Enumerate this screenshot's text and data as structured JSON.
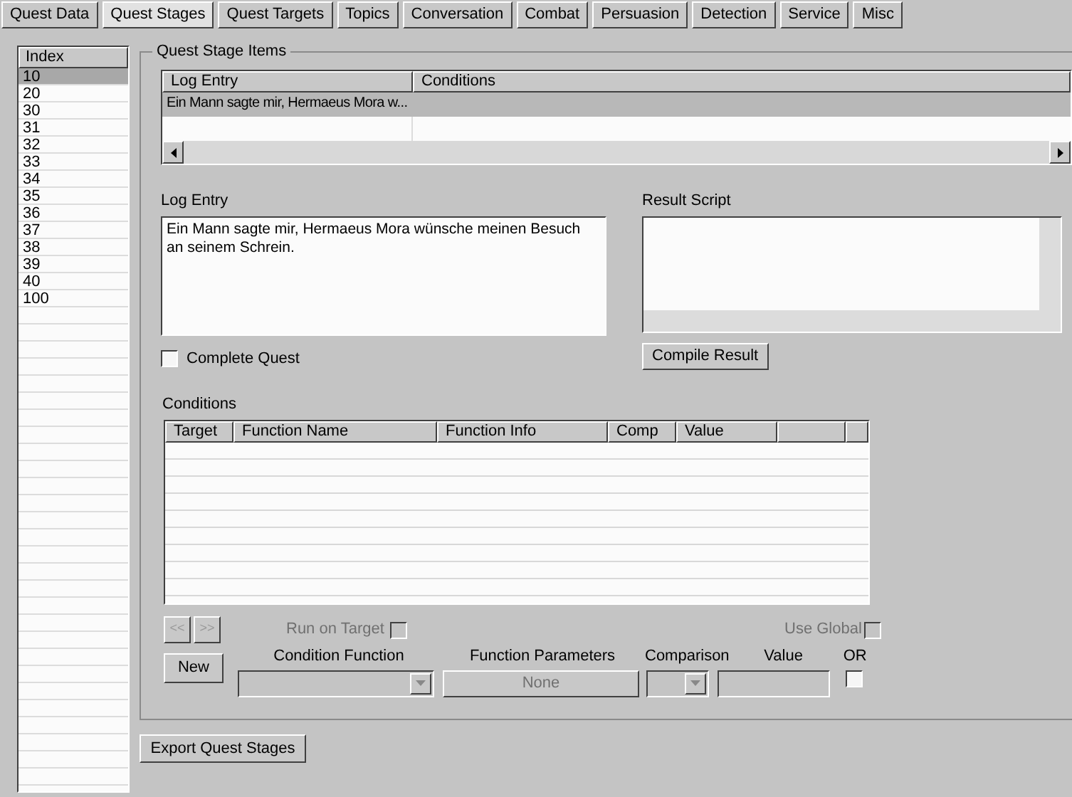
{
  "tabs": [
    {
      "label": "Quest Data",
      "selected": false
    },
    {
      "label": "Quest Stages",
      "selected": true
    },
    {
      "label": "Quest Targets",
      "selected": false
    },
    {
      "label": "Topics",
      "selected": false
    },
    {
      "label": "Conversation",
      "selected": false
    },
    {
      "label": "Combat",
      "selected": false
    },
    {
      "label": "Persuasion",
      "selected": false
    },
    {
      "label": "Detection",
      "selected": false
    },
    {
      "label": "Service",
      "selected": false
    },
    {
      "label": "Misc",
      "selected": false
    }
  ],
  "index_list": {
    "header": "Index",
    "items": [
      {
        "label": "10",
        "selected": true
      },
      {
        "label": "20",
        "selected": false
      },
      {
        "label": "30",
        "selected": false
      },
      {
        "label": "31",
        "selected": false
      },
      {
        "label": "32",
        "selected": false
      },
      {
        "label": "33",
        "selected": false
      },
      {
        "label": "34",
        "selected": false
      },
      {
        "label": "35",
        "selected": false
      },
      {
        "label": "36",
        "selected": false
      },
      {
        "label": "37",
        "selected": false
      },
      {
        "label": "38",
        "selected": false
      },
      {
        "label": "39",
        "selected": false
      },
      {
        "label": "40",
        "selected": false
      },
      {
        "label": "100",
        "selected": false
      }
    ]
  },
  "stage_items": {
    "title": "Quest Stage Items",
    "columns": [
      "Log Entry",
      "Conditions"
    ],
    "rows": [
      {
        "cells": [
          "Ein Mann sagte mir, Hermaeus Mora w...",
          ""
        ],
        "selected": true
      }
    ]
  },
  "log_entry": {
    "label": "Log Entry",
    "value": "Ein Mann sagte mir, Hermaeus Mora wünsche meinen Besuch an seinem Schrein."
  },
  "result_script": {
    "label": "Result Script"
  },
  "complete_quest": {
    "label": "Complete Quest",
    "checked": false
  },
  "compile_button": "Compile Result",
  "conditions": {
    "label": "Conditions",
    "columns": [
      "Target",
      "Function Name",
      "Function Info",
      "Comp",
      "Value"
    ]
  },
  "condition_editor": {
    "prev_button": {
      "label": "<<",
      "disabled": true
    },
    "next_button": {
      "label": ">>",
      "disabled": true
    },
    "run_on_target": {
      "label": "Run on Target",
      "checked": false,
      "disabled": true
    },
    "use_global": {
      "label": "Use Global",
      "checked": false,
      "disabled": true
    },
    "new_button": "New",
    "condition_function_label": "Condition Function",
    "function_parameters_label": "Function Parameters",
    "function_parameters_button": {
      "label": "None",
      "disabled": true
    },
    "comparison_label": "Comparison",
    "value_label": "Value",
    "or_label": "OR",
    "or_checked": false
  },
  "export_button": "Export Quest Stages"
}
